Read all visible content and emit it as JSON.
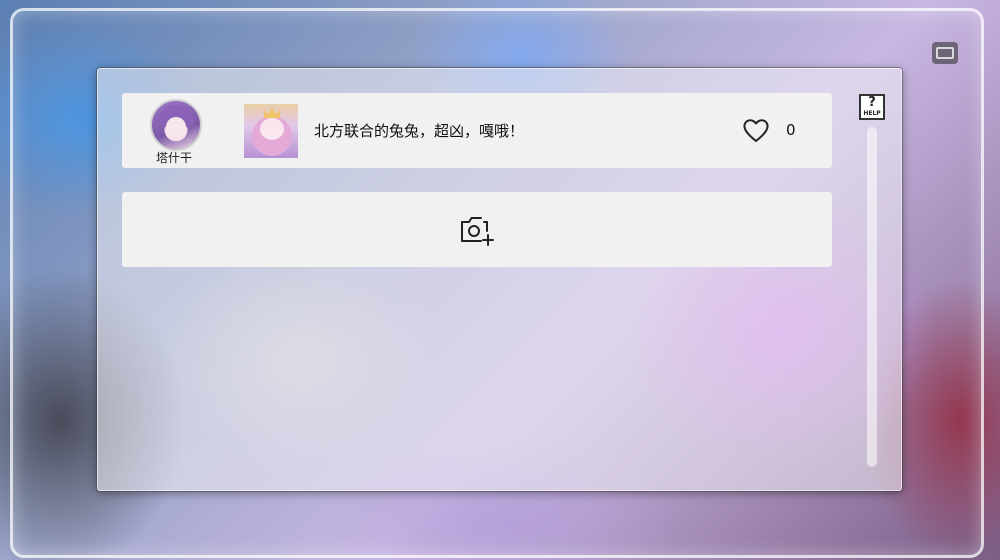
{
  "post": {
    "username": "塔什干",
    "message": "北方联合的兔兔，超凶，嘎哦！",
    "like_count": "0",
    "icons": {
      "avatar": "user-avatar",
      "thumbnail": "post-image-thumbnail",
      "like": "heart-outline-icon"
    }
  },
  "upload": {
    "icon": "camera-add-icon"
  },
  "help": {
    "symbol": "?",
    "label": "HELP"
  },
  "colors": {
    "row_background": "#f1f1f1",
    "panel_background": "rgba(240,238,244,0.55)",
    "text": "#111111"
  }
}
